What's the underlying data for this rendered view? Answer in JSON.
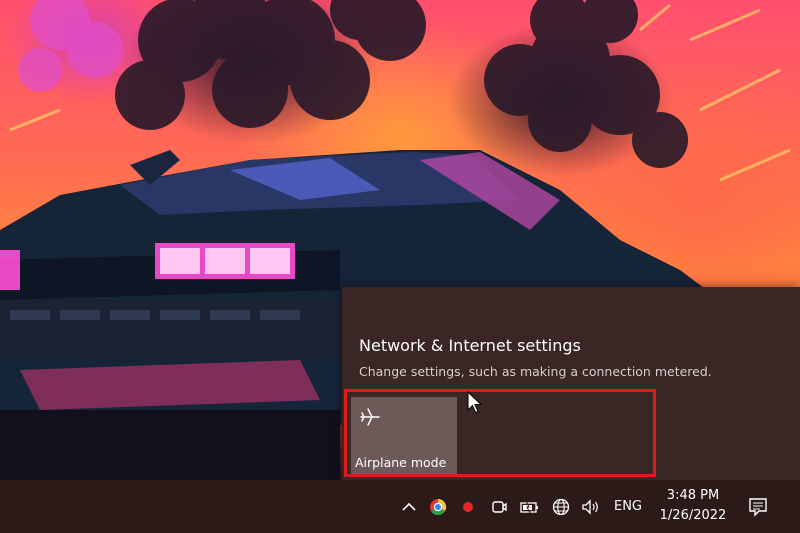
{
  "flyout": {
    "settings_link": "Network & Internet settings",
    "settings_description": "Change settings, such as making a connection metered.",
    "tiles": [
      {
        "label": "Airplane mode",
        "icon": "airplane-icon"
      }
    ]
  },
  "taskbar": {
    "tray_icons": [
      "chevron-up-icon",
      "chrome-icon",
      "record-icon",
      "meet-now-icon",
      "battery-icon",
      "network-globe-icon",
      "speaker-icon"
    ],
    "language": "ENG",
    "time": "3:48 PM",
    "date": "1/26/2022",
    "notification_icon": "notification-center-icon"
  },
  "colors": {
    "highlight_border": "#e0191b",
    "flyout_bg": "#3a2624",
    "tile_bg": "#6d5957",
    "taskbar_bg": "#2b1a18"
  }
}
